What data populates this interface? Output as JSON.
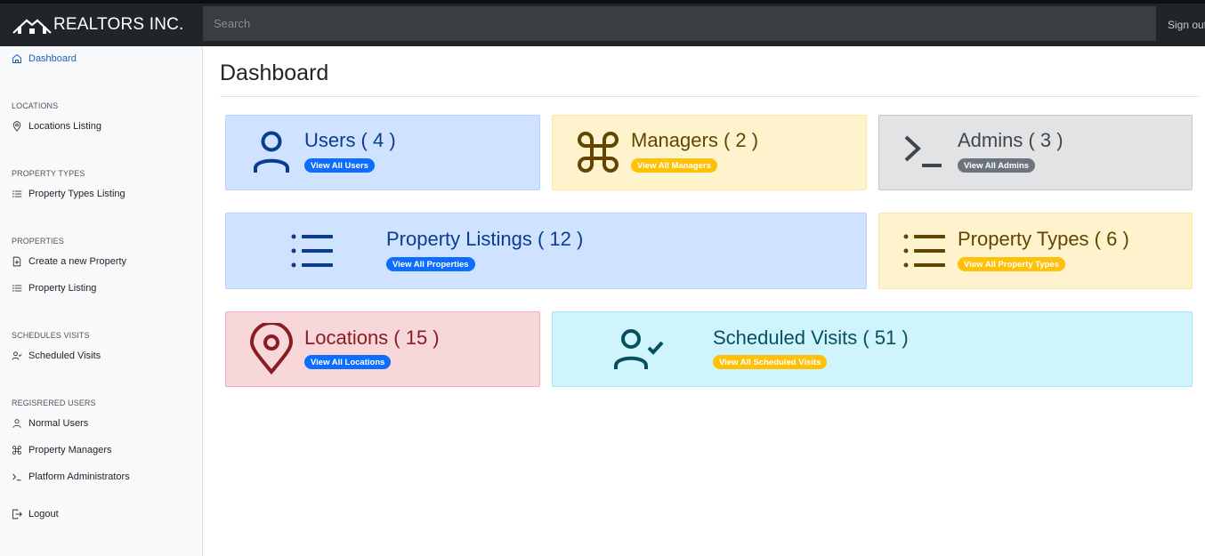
{
  "header": {
    "brand": "REALTORS INC.",
    "search_placeholder": "Search",
    "signout": "Sign out"
  },
  "sidebar": {
    "dashboard": "Dashboard",
    "sections": [
      {
        "heading": "LOCATIONS",
        "items": [
          "Locations Listing"
        ]
      },
      {
        "heading": "PROPERTY TYPES",
        "items": [
          "Property Types Listing"
        ]
      },
      {
        "heading": "PROPERTIES",
        "items": [
          "Create a new Property",
          "Property Listing"
        ]
      },
      {
        "heading": "SCHEDULES VISITS",
        "items": [
          "Scheduled Visits"
        ]
      },
      {
        "heading": "REGISRERED USERS",
        "items": [
          "Normal Users",
          "Property Managers",
          "Platform Administrators"
        ]
      }
    ],
    "logout": "Logout"
  },
  "main": {
    "title": "Dashboard",
    "cards": [
      {
        "title": "Users ( 4 )",
        "button": "View All Users",
        "icon": "person-icon",
        "color": "#cfe2ff"
      },
      {
        "title": "Managers ( 2 )",
        "button": "View All Managers",
        "icon": "command-icon",
        "color": "#fff3cd"
      },
      {
        "title": "Admins ( 3 )",
        "button": "View All Admins",
        "icon": "terminal-icon",
        "color": "#e2e3e5"
      },
      {
        "title": "Property Listings ( 12 )",
        "button": "View All Properties",
        "icon": "list-icon",
        "color": "#cfe2ff"
      },
      {
        "title": "Property Types ( 6 )",
        "button": "View All Property Types",
        "icon": "list-icon",
        "color": "#fff3cd"
      },
      {
        "title": "Locations ( 15 )",
        "button": "View All Locations",
        "icon": "location-pin-icon",
        "color": "#f8d7da"
      },
      {
        "title": "Scheduled Visits ( 51 )",
        "button": "View All Scheduled Visits",
        "icon": "person-check-icon",
        "color": "#cff4fc"
      }
    ]
  }
}
